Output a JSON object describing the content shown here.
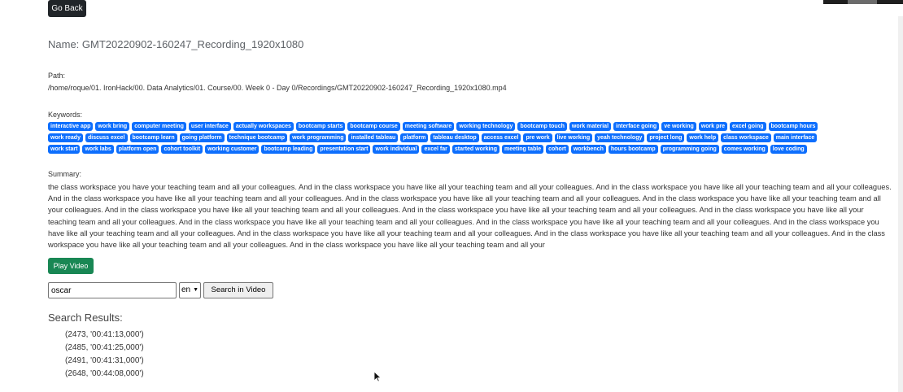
{
  "buttons": {
    "go_back": "Go Back",
    "play_video": "Play Video",
    "search_in_video": "Search in Video"
  },
  "name_line": "Name: GMT20220902-160247_Recording_1920x1080",
  "path": {
    "label": "Path:",
    "value": "/home/roque/01. IronHack/00. Data Analytics/01. Course/00. Week 0 - Day 0/Recordings/GMT20220902-160247_Recording_1920x1080.mp4"
  },
  "keywords": {
    "label": "Keywords:",
    "rows": [
      [
        "interactive app",
        "work bring",
        "computer meeting",
        "user interface",
        "actually workspaces",
        "bootcamp starts",
        "bootcamp course",
        "meeting software",
        "working technology",
        "bootcamp touch",
        "work material",
        "interface going",
        "ve working",
        "work pre",
        "excel going",
        "bootcamp hours"
      ],
      [
        "work ready",
        "discuss excel",
        "bootcamp learn",
        "going platform",
        "technique bootcamp",
        "work programming",
        "installed tableau",
        "platform",
        "tableau desktop",
        "access excel",
        "pre work",
        "live working",
        "yeah technology",
        "project long",
        "work help",
        "class workspace",
        "main interface"
      ],
      [
        "work start",
        "work labs",
        "platform open",
        "cohort toolkit",
        "working customer",
        "bootcamp leading",
        "presentation start",
        "work individual",
        "excel far",
        "started working",
        "meeting table",
        "cohort",
        "workbench",
        "hours bootcamp",
        "programming going",
        "comes working",
        "love coding"
      ]
    ]
  },
  "summary": {
    "label": "Summary:",
    "text": "the class workspace you have your teaching team and all your colleagues. And in the class workspace you have like all your teaching team and all your colleagues. And in the class workspace you have like all your teaching team and all your colleagues. And in the class workspace you have like all your teaching team and all your colleagues. And in the class workspace you have like all your teaching team and all your colleagues. And in the class workspace you have like all your teaching team and all your colleagues. And in the class workspace you have like all your teaching team and all your colleagues. And in the class workspace you have like all your teaching team and all your colleagues. And in the class workspace you have like all your teaching team and all your colleagues. And in the class workspace you have like all your teaching team and all your colleagues. And in the class workspace you have like all your teaching team and all your colleagues. And in the class workspace you have like all your teaching team and all your colleagues. And in the class workspace you have like all your teaching team and all your colleagues. And in the class workspace you have like all your teaching team and all your colleagues. And in the class workspace you have like all your teaching team and all your colleagues. And in the class workspace you have like all your teaching team and all your"
  },
  "search": {
    "value": "oscar",
    "language": "en"
  },
  "results": {
    "title": "Search Results:",
    "items": [
      "(2473, '00:41:13,000')",
      "(2485, '00:41:25,000')",
      "(2491, '00:41:31,000')",
      "(2648, '00:44:08,000')"
    ]
  },
  "colors": {
    "keyword_badge": "#0d6efd",
    "play_button": "#198754",
    "back_button": "#212529"
  },
  "icons": {
    "select_chevron": "chevron-down-icon",
    "cursor": "mouse-pointer-icon"
  }
}
